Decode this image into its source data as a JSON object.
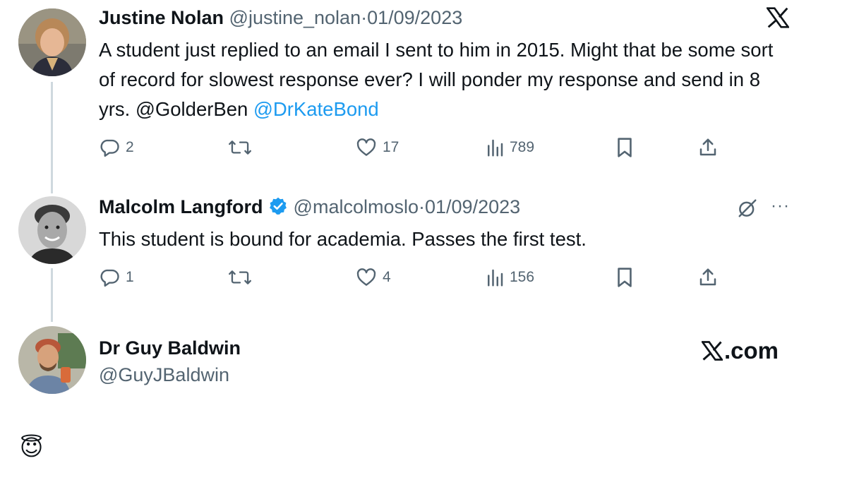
{
  "tweets": [
    {
      "author_name": "Justine Nolan",
      "handle": "@justine_nolan",
      "separator": "·",
      "date": "01/09/2023",
      "text_parts": [
        "A student just replied to an email I sent to him in 2015. Might that be some sort of record for slowest response ever? I will ponder my response and send in 8 yrs. @GolderBen "
      ],
      "mention_link": "@DrKateBond",
      "replies": "2",
      "likes": "17",
      "views": "789"
    },
    {
      "author_name": "Malcolm Langford",
      "handle": "@malcolmoslo",
      "separator": "·",
      "date": "01/09/2023",
      "text": "This student is bound for academia. Passes the first test.",
      "replies": "1",
      "likes": "4",
      "views": "156",
      "more": "···"
    },
    {
      "author_name": "Dr Guy Baldwin",
      "handle": "@GuyJBaldwin",
      "reply_text": "😇"
    }
  ],
  "watermark": "X.com",
  "colors": {
    "link": "#1d9bf0",
    "muted": "#536471",
    "verified": "#1d9bf0"
  },
  "icons": [
    "x-logo-icon",
    "reply-icon",
    "retweet-icon",
    "like-icon",
    "views-icon",
    "bookmark-icon",
    "share-icon",
    "verified-badge-icon",
    "grok-icon",
    "more-icon"
  ]
}
